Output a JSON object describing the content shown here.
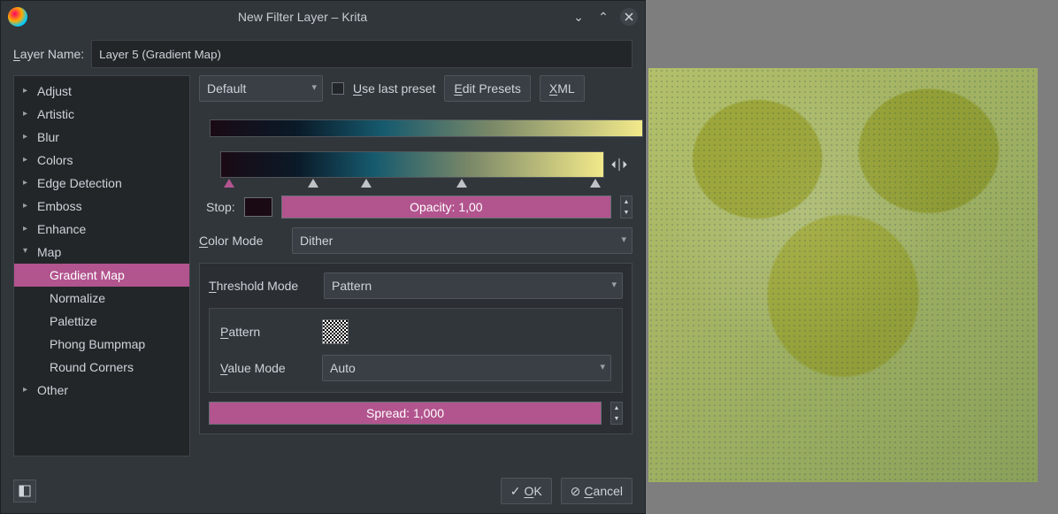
{
  "titlebar": {
    "title": "New Filter Layer – Krita"
  },
  "label": {
    "layer_name": "Layer Name:"
  },
  "layer_name_value": "Layer 5 (Gradient Map)",
  "sidebar": {
    "items": [
      {
        "label": "Adjust",
        "expanded": false,
        "children": []
      },
      {
        "label": "Artistic",
        "expanded": false,
        "children": []
      },
      {
        "label": "Blur",
        "expanded": false,
        "children": []
      },
      {
        "label": "Colors",
        "expanded": false,
        "children": []
      },
      {
        "label": "Edge Detection",
        "expanded": false,
        "children": []
      },
      {
        "label": "Emboss",
        "expanded": false,
        "children": []
      },
      {
        "label": "Enhance",
        "expanded": false,
        "children": []
      },
      {
        "label": "Map",
        "expanded": true,
        "children": [
          {
            "label": "Gradient Map",
            "selected": true
          },
          {
            "label": "Normalize"
          },
          {
            "label": "Palettize"
          },
          {
            "label": "Phong Bumpmap"
          },
          {
            "label": "Round Corners"
          }
        ]
      },
      {
        "label": "Other",
        "expanded": false,
        "children": []
      }
    ]
  },
  "toolbar": {
    "preset": "Default",
    "use_last_preset": "Use last preset",
    "edit_presets": "Edit Presets",
    "xml": "XML"
  },
  "gradient": {
    "stops_percent": [
      2,
      24,
      38,
      63,
      98
    ],
    "selected_stop": 0,
    "stop_label": "Stop:",
    "stop_color": "#1a0a14",
    "opacity_label": "Opacity: 1,00"
  },
  "color_mode": {
    "label": "Color Mode",
    "value": "Dither"
  },
  "threshold": {
    "label": "Threshold Mode",
    "value": "Pattern"
  },
  "pattern": {
    "label": "Pattern"
  },
  "value_mode": {
    "label": "Value Mode",
    "value": "Auto"
  },
  "spread": {
    "label": "Spread:  1,000"
  },
  "buttons": {
    "ok": "OK",
    "cancel": "Cancel"
  }
}
